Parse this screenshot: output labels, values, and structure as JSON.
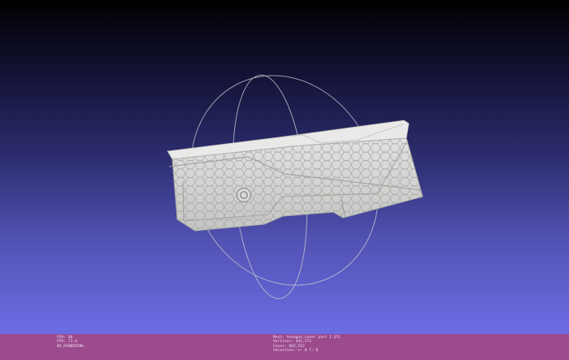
{
  "status": {
    "left": [
      "FOV: 60",
      "FPS:   71.6",
      "BO_RENDERING"
    ],
    "right": [
      "Mesh: hexagon_cover part 1.STL",
      "Vertices: 441,272",
      "Faces: 882,552",
      "Selection: v: 0  f: 0"
    ]
  },
  "colors": {
    "viewport_top": "#000000",
    "viewport_bottom": "#6d6de4",
    "status_bar": "#9b4b8d",
    "mesh": "#d4d4d2",
    "trackball": "#c8c8d0"
  },
  "icons": {
    "trackball": "trackball-gizmo",
    "model": "3d-mesh-model"
  }
}
